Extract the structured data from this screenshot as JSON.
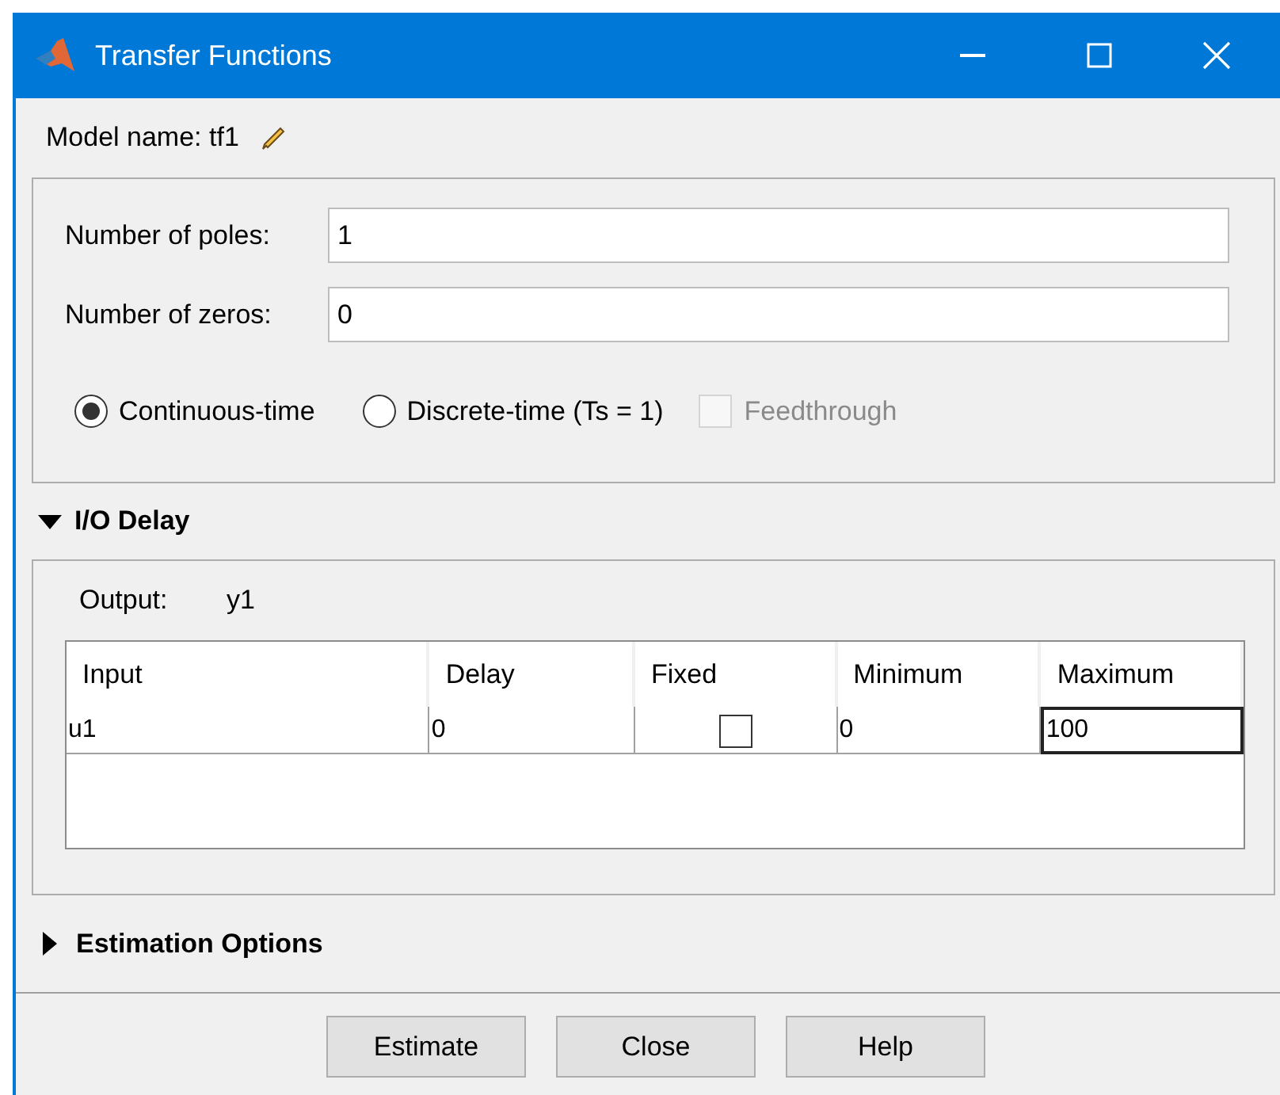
{
  "window": {
    "title": "Transfer Functions"
  },
  "model_name": "Model name: tf1",
  "fields": [
    {
      "label": "Number of poles:",
      "value": "1"
    },
    {
      "label": "Number of zeros:",
      "value": "0"
    }
  ],
  "time_options": [
    {
      "kind": "radio",
      "label": "Continuous-time",
      "selected": true,
      "disabled": false
    },
    {
      "kind": "radio",
      "label": "Discrete-time (Ts = 1)",
      "selected": false,
      "disabled": false
    },
    {
      "kind": "checkbox",
      "label": "Feedthrough",
      "checked": false,
      "disabled": true
    }
  ],
  "io_delay": {
    "title": "I/O Delay",
    "expanded": true,
    "output_label": "Output:",
    "output_value": "y1",
    "table": {
      "columns": [
        "Input",
        "Delay",
        "Fixed",
        "Minimum",
        "Maximum"
      ],
      "rows": [
        {
          "cells": [
            {
              "kind": "text",
              "text": "u1",
              "focused": false
            },
            {
              "kind": "text",
              "text": "0",
              "focused": false
            },
            {
              "kind": "checkbox",
              "checked": false,
              "focused": false
            },
            {
              "kind": "text",
              "text": "0",
              "focused": false
            },
            {
              "kind": "text",
              "text": "100",
              "focused": true
            }
          ]
        }
      ]
    }
  },
  "estimation_options": {
    "title": "Estimation Options",
    "expanded": false
  },
  "buttons": [
    "Estimate",
    "Close",
    "Help"
  ]
}
